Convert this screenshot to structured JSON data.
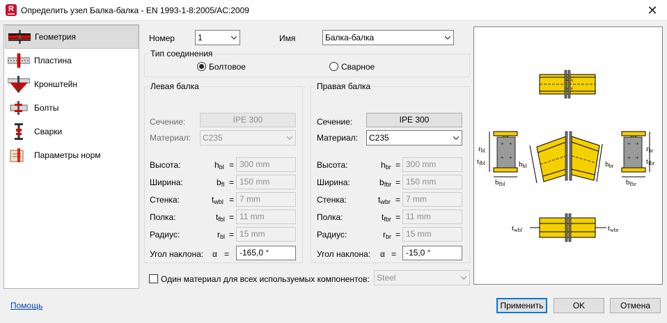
{
  "window": {
    "title": "Определить узел Балка-балка - EN 1993-1-8:2005/AC:2009",
    "app_icon_letter": "R",
    "close_glyph": "✕"
  },
  "nav": {
    "items": [
      {
        "label": "Геометрия",
        "icon": "beam-geometry-icon",
        "selected": true
      },
      {
        "label": "Пластина",
        "icon": "plate-icon",
        "selected": false
      },
      {
        "label": "Кронштейн",
        "icon": "bracket-icon",
        "selected": false
      },
      {
        "label": "Болты",
        "icon": "bolts-icon",
        "selected": false
      },
      {
        "label": "Сварки",
        "icon": "welds-icon",
        "selected": false
      },
      {
        "label": "Параметры норм",
        "icon": "code-parameters-icon",
        "selected": false
      }
    ]
  },
  "header": {
    "number_label": "Номер",
    "number_value": "1",
    "name_label": "Имя",
    "name_value": "Балка-балка"
  },
  "connection_type": {
    "title": "Тип соединения",
    "bolted_label": "Болтовое",
    "welded_label": "Сварное",
    "selected": "bolted"
  },
  "left_beam": {
    "title": "Левая балка",
    "section_label": "Сечение:",
    "section_value": "IPE 300",
    "material_label": "Материал:",
    "material_value": "C235",
    "rows": [
      {
        "label": "Высота:",
        "sym": "h",
        "sub": "bl",
        "value": "300 mm"
      },
      {
        "label": "Ширина:",
        "sym": "b",
        "sub": "fl",
        "value": "150 mm"
      },
      {
        "label": "Стенка:",
        "sym": "t",
        "sub": "wbl",
        "value": "7 mm"
      },
      {
        "label": "Полка:",
        "sym": "t",
        "sub": "fbl",
        "value": "11 mm"
      },
      {
        "label": "Радиус:",
        "sym": "r",
        "sub": "bl",
        "value": "15 mm"
      }
    ],
    "angle_label": "Угол наклона:",
    "angle_sym": "α",
    "angle_value": "-165,0 °"
  },
  "right_beam": {
    "title": "Правая балка",
    "section_label": "Сечение:",
    "section_value": "IPE 300",
    "material_label": "Материал:",
    "material_value": "C235",
    "rows": [
      {
        "label": "Высота:",
        "sym": "h",
        "sub": "br",
        "value": "300 mm"
      },
      {
        "label": "Ширина:",
        "sym": "b",
        "sub": "fbr",
        "value": "150 mm"
      },
      {
        "label": "Стенка:",
        "sym": "t",
        "sub": "wbr",
        "value": "7 mm"
      },
      {
        "label": "Полка:",
        "sym": "t",
        "sub": "fbr",
        "value": "11 mm"
      },
      {
        "label": "Радиус:",
        "sym": "r",
        "sub": "br",
        "value": "15 mm"
      }
    ],
    "angle_label": "Угол наклона:",
    "angle_sym": "α",
    "angle_value": "-15,0 °"
  },
  "equals": "=",
  "same_material": {
    "label": "Один материал для всех используемых компонентов:",
    "checked": false,
    "value": "Steel"
  },
  "preview_labels": {
    "r_bl": "r",
    "r_bl_sub": "bl",
    "t_fbl": "t",
    "t_fbl_sub": "fbl",
    "h_bl": "h",
    "h_bl_sub": "bl",
    "h_br": "h",
    "h_br_sub": "br",
    "b_fbl": "b",
    "b_fbl_sub": "fbl",
    "b_fbr": "b",
    "b_fbr_sub": "fbr",
    "r_br": "r",
    "r_br_sub": "br",
    "t_fbr": "t",
    "t_fbr_sub": "fbr",
    "t_wbl": "t",
    "t_wbl_sub": "wbl",
    "t_wbr": "t",
    "t_wbr_sub": "wbr"
  },
  "footer": {
    "help_label": "Помощь",
    "apply_label": "Применить",
    "ok_label": "OK",
    "cancel_label": "Отмена"
  },
  "colors": {
    "beam_yellow": "#f5d000",
    "beam_outline": "#000000",
    "plate_gray": "#9a9a9a",
    "accent": "#0078d7",
    "close_red": "#c8102e"
  }
}
